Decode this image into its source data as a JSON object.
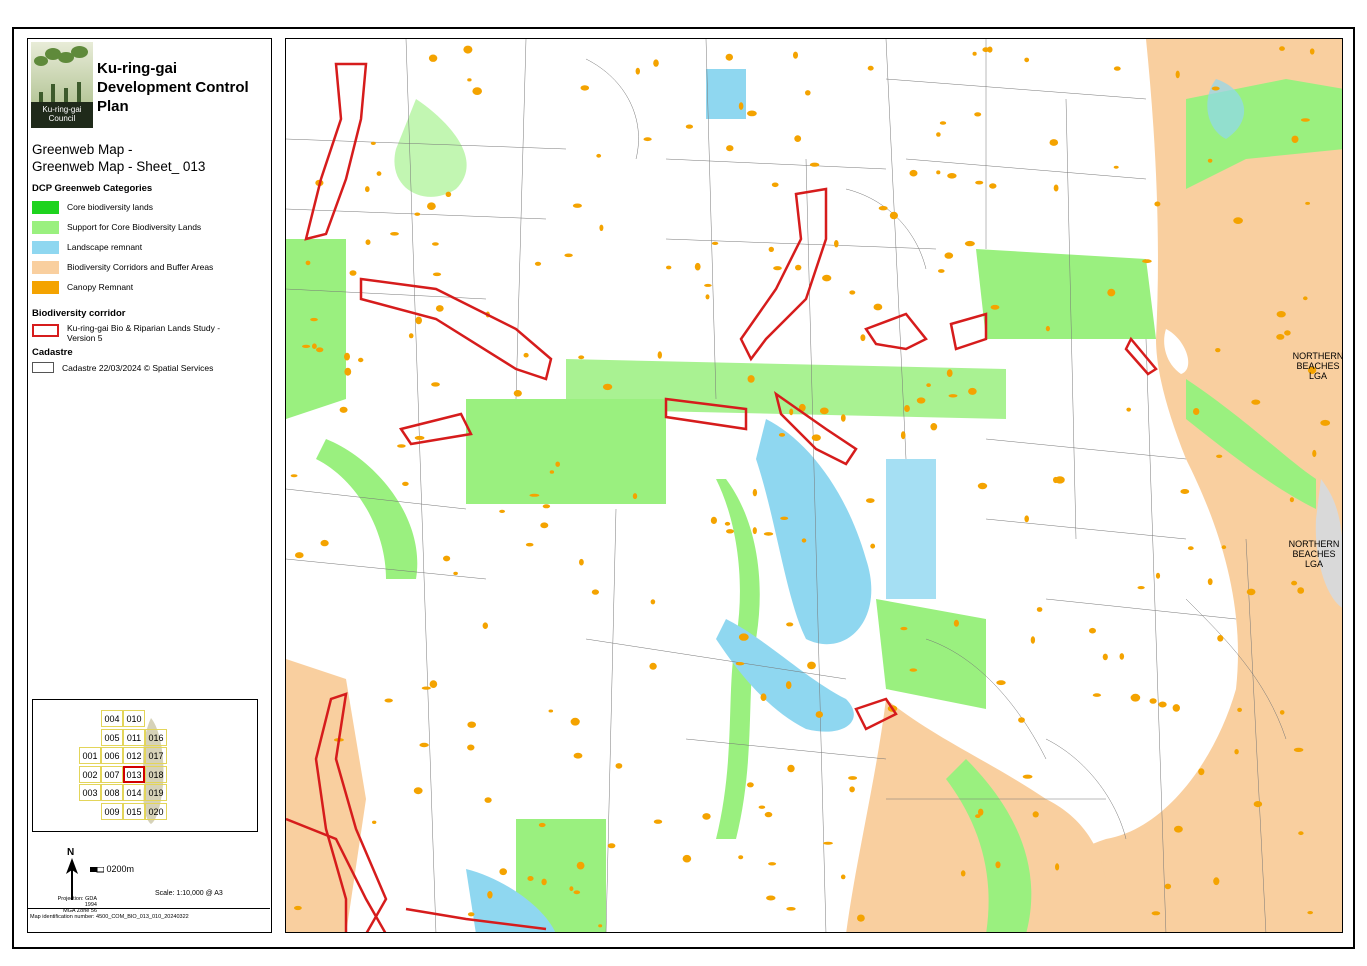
{
  "header": {
    "council_logo_text": "Ku-ring-gai Council",
    "plan_title_line1": "Ku-ring-gai",
    "plan_title_line2": "Development Control",
    "plan_title_line3": "Plan",
    "map_title_line1": "Greenweb Map -",
    "map_title_line2": "Greenweb Map - Sheet_ 013"
  },
  "legend": {
    "section_greenweb": "DCP Greenweb Categories",
    "items": [
      {
        "label": "Core biodiversity lands",
        "color": "#1ed31e"
      },
      {
        "label": "Support for Core Biodiversity Lands",
        "color": "#9af07f"
      },
      {
        "label": "Landscape remnant",
        "color": "#8fd7f0"
      },
      {
        "label": "Biodiversity Corridors and Buffer Areas",
        "color": "#f9cf9f"
      },
      {
        "label": "Canopy Remnant",
        "color": "#f4a300"
      }
    ],
    "section_corridor": "Biodiversity corridor",
    "corridor_label": "Ku-ring-gai Bio & Riparian Lands Study - Version 5",
    "corridor_color": "#d61c1c",
    "section_cadastre": "Cadastre",
    "cadastre_label": "Cadastre 22/03/2024 © Spatial Services"
  },
  "index_grid": {
    "current_sheet": "013",
    "rows": [
      [
        "004",
        "010"
      ],
      [
        "005",
        "011",
        "016"
      ],
      [
        "001",
        "006",
        "012",
        "017"
      ],
      [
        "002",
        "007",
        "013",
        "018"
      ],
      [
        "003",
        "008",
        "014",
        "019"
      ],
      [
        "009",
        "015",
        "020"
      ]
    ]
  },
  "footer": {
    "north_label": "N",
    "scale_bar_label": "0200m",
    "projection_line1": "Projection: GDA 1994",
    "projection_line2": "MGA Zone 56",
    "scale_text": "Scale: 1:10,000  @ A3",
    "map_id": "Map identification number:  4500_COM_BIO_013_010_20240322"
  },
  "map": {
    "lga_label_1": "NORTHERN BEACHES LGA",
    "lga_label_2": "NORTHERN BEACHES LGA",
    "lga_label_1_lines": [
      "NORTHERN",
      "BEACHES",
      "LGA"
    ],
    "lga_label_2_lines": [
      "NORTHERN",
      "BEACHES",
      "LGA"
    ]
  }
}
